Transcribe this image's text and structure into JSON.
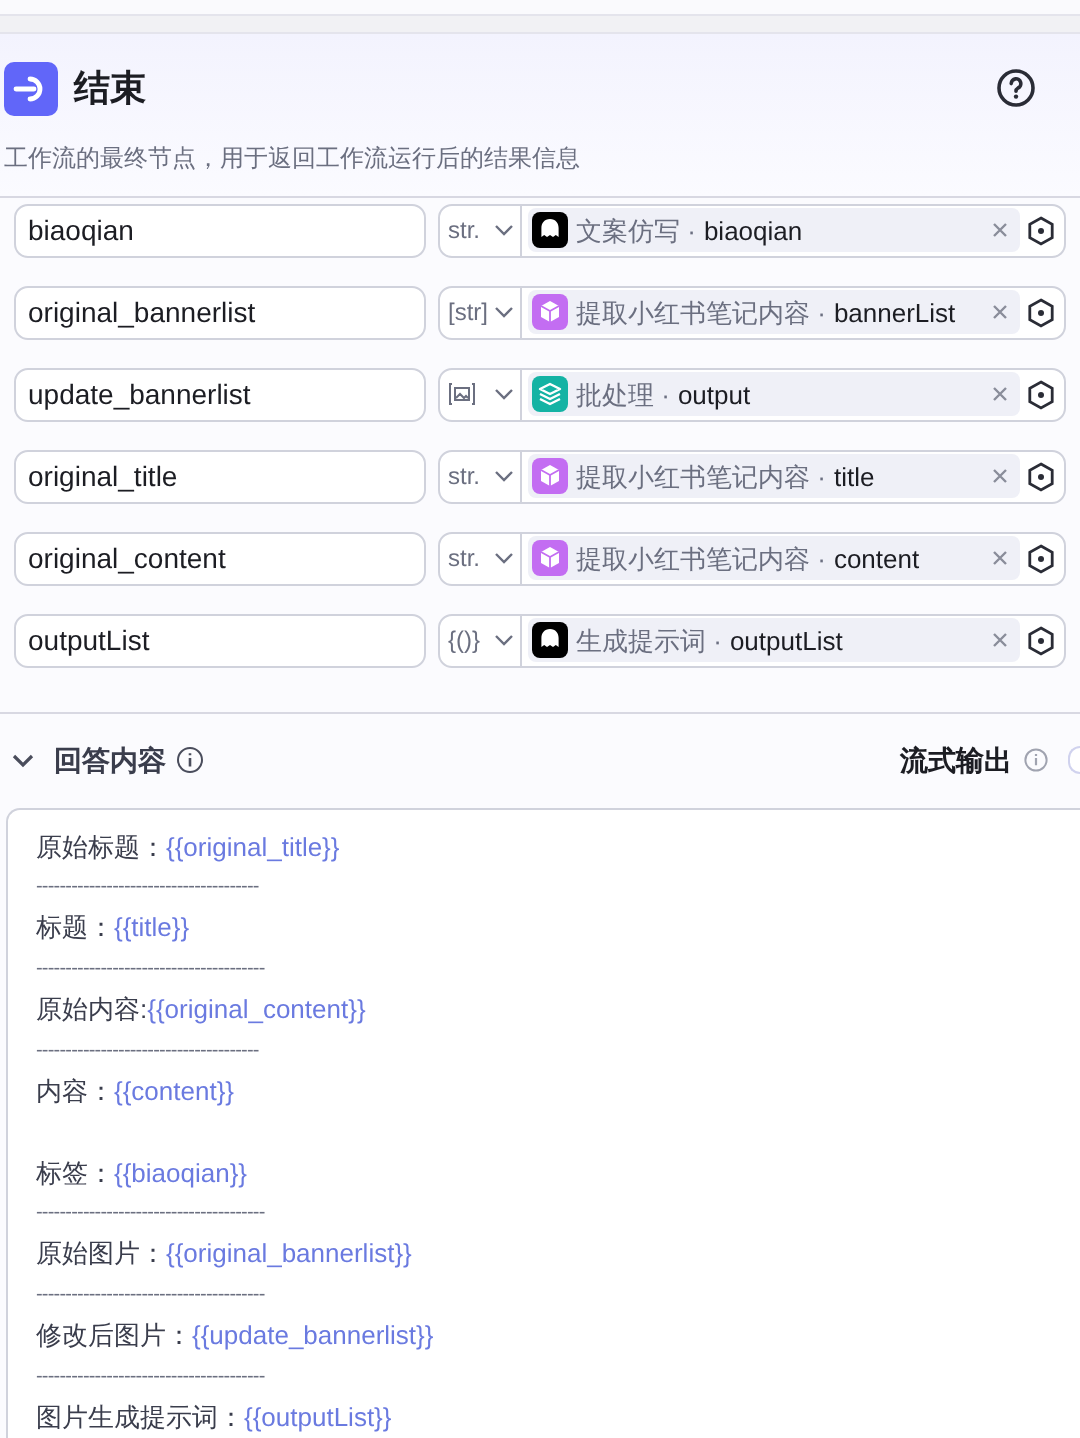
{
  "node": {
    "title": "结束",
    "description": "工作流的最终节点，用于返回工作流运行后的结果信息"
  },
  "outputs": [
    {
      "name": "biaoqian",
      "type": {
        "kind": "text",
        "label": "str."
      },
      "source": {
        "kind": "bot",
        "node": "文案仿写 ·",
        "field": "biaoqian"
      }
    },
    {
      "name": "original_bannerlist",
      "type": {
        "kind": "text",
        "label": "[str]"
      },
      "source": {
        "kind": "cube",
        "node": "提取小红书笔记内容 ·",
        "field": "bannerList"
      }
    },
    {
      "name": "update_bannerlist",
      "type": {
        "kind": "image"
      },
      "source": {
        "kind": "layers",
        "node": "批处理 ·",
        "field": "output"
      }
    },
    {
      "name": "original_title",
      "type": {
        "kind": "text",
        "label": "str."
      },
      "source": {
        "kind": "cube",
        "node": "提取小红书笔记内容 ·",
        "field": "title"
      }
    },
    {
      "name": "original_content",
      "type": {
        "kind": "text",
        "label": "str."
      },
      "source": {
        "kind": "cube",
        "node": "提取小红书笔记内容 ·",
        "field": "content"
      }
    },
    {
      "name": "outputList",
      "type": {
        "kind": "text",
        "label": "{()}"
      },
      "source": {
        "kind": "bot",
        "node": "生成提示词 ·",
        "field": "outputList"
      }
    }
  ],
  "answer": {
    "title": "回答内容",
    "stream_label": "流式输出",
    "lines": [
      {
        "kind": "field",
        "label": "原始标题：",
        "variable": "{{original_title}}"
      },
      {
        "kind": "divider",
        "text": "--------------------------------------"
      },
      {
        "kind": "field",
        "label": "标题：",
        "variable": "{{title}}"
      },
      {
        "kind": "divider",
        "text": "---------------------------------------"
      },
      {
        "kind": "field",
        "label": "原始内容:",
        "variable": "{{original_content}}"
      },
      {
        "kind": "divider",
        "text": "--------------------------------------"
      },
      {
        "kind": "field",
        "label": "内容：",
        "variable": "{{content}}"
      },
      {
        "kind": "blank"
      },
      {
        "kind": "field",
        "label": "标签：",
        "variable": "{{biaoqian}}"
      },
      {
        "kind": "divider",
        "text": "---------------------------------------"
      },
      {
        "kind": "field",
        "label": "原始图片：",
        "variable": "{{original_bannerlist}}"
      },
      {
        "kind": "divider",
        "text": "---------------------------------------"
      },
      {
        "kind": "field",
        "label": "修改后图片：",
        "variable": "{{update_bannerlist}}"
      },
      {
        "kind": "divider",
        "text": "---------------------------------------"
      },
      {
        "kind": "field",
        "label": "图片生成提示词：",
        "variable": "{{outputList}}"
      }
    ]
  }
}
